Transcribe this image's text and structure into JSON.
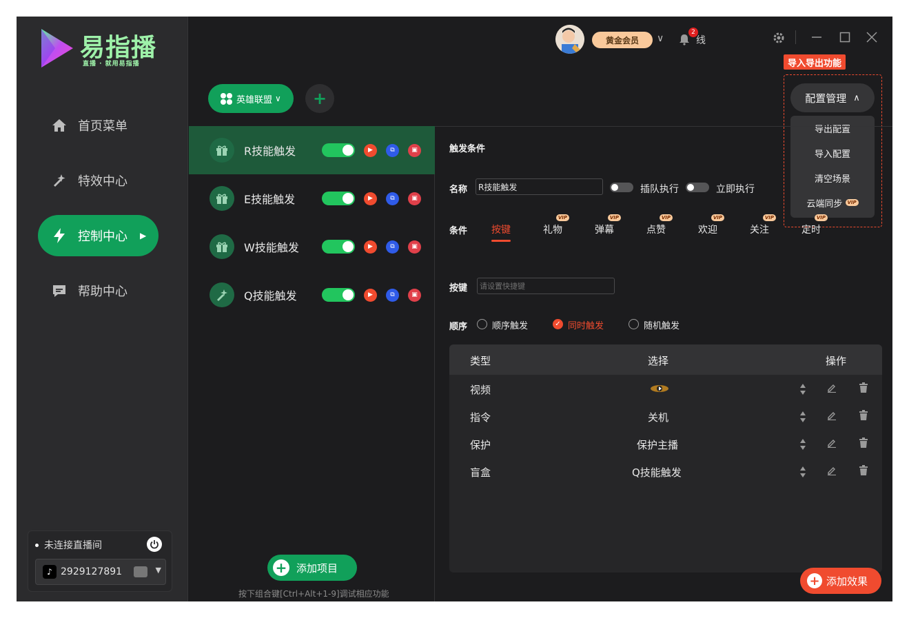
{
  "brand": {
    "name": "易指播",
    "slogan": "直播 · 就用易指播"
  },
  "sidebar": {
    "items": [
      {
        "label": "首页菜单",
        "icon": "home-icon"
      },
      {
        "label": "特效中心",
        "icon": "sparkle-icon"
      },
      {
        "label": "控制中心",
        "icon": "bolt-icon",
        "active": true
      },
      {
        "label": "帮助中心",
        "icon": "chat-icon"
      }
    ],
    "live": {
      "status": "未连接直播间",
      "account": "2929127891"
    }
  },
  "topbar": {
    "vip_label": "黄金会员",
    "notification_count": "2",
    "offline_label": "线"
  },
  "toolbar": {
    "game_label": "英雄联盟",
    "add_symbol": "+"
  },
  "config": {
    "tooltip": "导入导出功能",
    "button_label": "配置管理",
    "menu": [
      "导出配置",
      "导入配置",
      "清空场景",
      "云端同步"
    ],
    "vip_badge": "VIP"
  },
  "projects": {
    "items": [
      {
        "name": "R技能触发",
        "icon": "gift-icon",
        "active": true
      },
      {
        "name": "E技能触发",
        "icon": "gift-icon"
      },
      {
        "name": "W技能触发",
        "icon": "gift-icon"
      },
      {
        "name": "Q技能触发",
        "icon": "sparkle-icon"
      }
    ],
    "add_label": "添加项目",
    "hint": "按下组合键[Ctrl+Alt+1-9]调试相应功能"
  },
  "detail": {
    "title": "触发条件",
    "name_label": "名称",
    "name_value": "R技能触发",
    "queue_label": "插队执行",
    "immediate_label": "立即执行",
    "condition_label": "条件",
    "tabs": [
      {
        "label": "按键",
        "vip": false,
        "active": true
      },
      {
        "label": "礼物",
        "vip": true
      },
      {
        "label": "弹幕",
        "vip": true
      },
      {
        "label": "点赞",
        "vip": true
      },
      {
        "label": "欢迎",
        "vip": true
      },
      {
        "label": "关注",
        "vip": true
      },
      {
        "label": "定时",
        "vip": true
      }
    ],
    "key_label": "按键",
    "key_placeholder": "请设置快捷键",
    "order_label": "顺序",
    "order_options": [
      "顺序触发",
      "同时触发",
      "随机触发"
    ],
    "table": {
      "headers": [
        "类型",
        "选择",
        "操作"
      ],
      "rows": [
        {
          "type": "视频",
          "select": ""
        },
        {
          "type": "指令",
          "select": "关机"
        },
        {
          "type": "保护",
          "select": "保护主播"
        },
        {
          "type": "盲盒",
          "select": "Q技能触发"
        }
      ]
    },
    "add_effect_label": "添加效果"
  },
  "colors": {
    "green": "#11a05a",
    "orange": "#f04b2f",
    "bg": "#1c1c1e",
    "vip": "#f9c99b"
  }
}
